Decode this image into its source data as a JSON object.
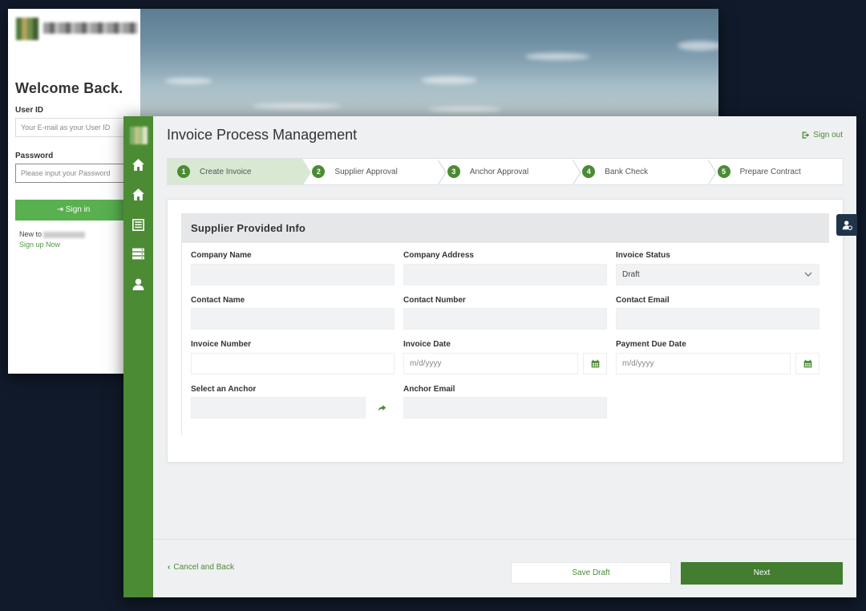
{
  "login": {
    "welcome": "Welcome Back.",
    "user_id_label": "User ID",
    "user_id_placeholder": "Your E-mail as your User ID",
    "password_label": "Password",
    "password_placeholder": "Please input your Password",
    "sign_in": "Sign in",
    "new_to": "New to",
    "sign_up": "Sign up Now"
  },
  "main": {
    "title": "Invoice Process Management",
    "sign_out": "Sign out",
    "steps": [
      {
        "num": "1",
        "label": "Create Invoice"
      },
      {
        "num": "2",
        "label": "Supplier Approval"
      },
      {
        "num": "3",
        "label": "Anchor Approval"
      },
      {
        "num": "4",
        "label": "Bank Check"
      },
      {
        "num": "5",
        "label": "Prepare Contract"
      }
    ],
    "section_title": "Supplier Provided Info",
    "fields": {
      "company_name": "Company Name",
      "company_address": "Company Address",
      "invoice_status": "Invoice Status",
      "invoice_status_value": "Draft",
      "contact_name": "Contact Name",
      "contact_number": "Contact Number",
      "contact_email": "Contact Email",
      "invoice_number": "Invoice Number",
      "invoice_date": "Invoice Date",
      "payment_due_date": "Payment Due Date",
      "date_placeholder": "m/d/yyyy",
      "select_anchor": "Select an Anchor",
      "anchor_email": "Anchor Email"
    },
    "footer": {
      "cancel_back": "Cancel and Back",
      "save_draft": "Save Draft",
      "next": "Next"
    }
  },
  "colors": {
    "brand_green": "#4b8b34",
    "sign_in_green": "#58b04e",
    "active_step_bg": "#d8e8d3",
    "background": "#111a2a"
  }
}
